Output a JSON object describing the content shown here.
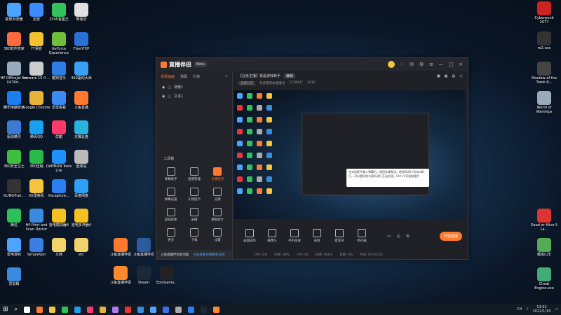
{
  "desktop_icons_left": [
    {
      "label": "联想浏览器\nHP OfficeJ...",
      "color": "#4aa3ff"
    },
    {
      "label": "迅雷",
      "color": "#3b8cff"
    },
    {
      "label": "2345看图王",
      "color": "#32c45b"
    },
    {
      "label": "网易云",
      "color": "#e0e0e0"
    },
    {
      "label": "360软件管家",
      "color": "#ff6b3d"
    },
    {
      "label": "YY语音",
      "color": "#f2c230"
    },
    {
      "label": "GeForce Experience",
      "color": "#6fbf3a"
    },
    {
      "label": "FlashFXP",
      "color": "#2b6fd9"
    },
    {
      "label": "HP Officejet Pro X476d...",
      "color": "#9ab"
    },
    {
      "label": "vmware 15 0 ...",
      "color": "#ccc"
    },
    {
      "label": "酷狗音乐",
      "color": "#2d7de3"
    },
    {
      "label": "360驱动大师",
      "color": "#39a0f5"
    },
    {
      "label": "腾讯电脑管家",
      "color": "#1b7ef0"
    },
    {
      "label": "Google Chrome",
      "color": "#e8b33b"
    },
    {
      "label": "迅雷看看",
      "color": "#3d8bf2"
    },
    {
      "label": "斗鱼直播",
      "color": "#ff7a2e"
    },
    {
      "label": "驱动精灵",
      "color": "#3a7bd5"
    },
    {
      "label": "腾讯QQ",
      "color": "#1aa0f0"
    },
    {
      "label": "优酷",
      "color": "#ff3a6a"
    },
    {
      "label": "天翼云盘",
      "color": "#2bb3e0"
    },
    {
      "label": "360安全卫士",
      "color": "#3fbf3f"
    },
    {
      "label": "360压缩",
      "color": "#2ab84a"
    },
    {
      "label": "DAEMON Tools Lite",
      "color": "#1f90ff"
    },
    {
      "label": "回收站",
      "color": "#bbb"
    },
    {
      "label": "KLINGTrail...",
      "color": "#333"
    },
    {
      "label": "KK录像机",
      "color": "#f5c542"
    },
    {
      "label": "Kscapture...",
      "color": "#2a7ff0"
    },
    {
      "label": "百度网盘",
      "color": "#2ea1f5"
    },
    {
      "label": "微信",
      "color": "#2dc15a"
    },
    {
      "label": "HP Print and Scan Doctor",
      "color": "#3a8be0"
    },
    {
      "label": "雷电模拟器4",
      "color": "#f5c020"
    },
    {
      "label": "雷电多开器4",
      "color": "#f5c020"
    },
    {
      "label": "雷电游戏",
      "color": "#4fa3ff"
    },
    {
      "label": "SimpleVpn",
      "color": "#3c7de0"
    },
    {
      "label": "文档",
      "color": "#f2d36b"
    },
    {
      "label": "etc",
      "color": "#f2d36b"
    },
    {
      "label": "爱剪辑",
      "color": "#3a8be0"
    }
  ],
  "desktop_icons_bottom": [
    {
      "label": "斗鱼直播伴侣\n直播伴侣",
      "color": "#ff7a2e"
    },
    {
      "label": "斗鱼直播伴侣",
      "color": "#2b5d9e"
    },
    {
      "label": "斗鱼直播伴侣",
      "color": "#ff8a2e"
    },
    {
      "label": "Steam",
      "color": "#1b2838"
    },
    {
      "label": "EpicGame...",
      "color": "#222"
    }
  ],
  "desktop_icons_right": [
    {
      "label": "Cyberpunk 2077",
      "color": "#c22"
    },
    {
      "label": "re2.exe",
      "color": "#333"
    },
    {
      "label": "Shadow of the Tomb R...",
      "color": "#444"
    },
    {
      "label": "World of Warships",
      "color": "#9ab"
    },
    {
      "label": "Dead or Alive 5 La...",
      "color": "#d33"
    },
    {
      "label": "模拟山羊",
      "color": "#5a5"
    },
    {
      "label": "Cheat Engine.exe",
      "color": "#4a7"
    }
  ],
  "app": {
    "logo": "直播伴侣",
    "version": "Beta",
    "tabs": [
      "场景画面",
      "弹幕",
      "礼物"
    ],
    "scenes": [
      "场景1",
      "文本1"
    ],
    "tools_title": "工具箱",
    "tools": [
      {
        "label": "弹幕助手",
        "orange": false
      },
      {
        "label": "直播管理",
        "orange": false
      },
      {
        "label": "主播任务",
        "orange": true
      },
      {
        "label": "弹幕设置",
        "orange": false
      },
      {
        "label": "礼物提示",
        "orange": false
      },
      {
        "label": "竞猜",
        "orange": false
      },
      {
        "label": "虚拟形象",
        "orange": false
      },
      {
        "label": "录播",
        "orange": false
      },
      {
        "label": "数据统计",
        "orange": false
      },
      {
        "label": "更多",
        "orange": false
      },
      {
        "label": "下载",
        "orange": false
      },
      {
        "label": "设置",
        "orange": false
      }
    ],
    "notice": "斗鱼直播伴侣新功能",
    "notice_link": "点击查看详细更新说明",
    "room_title": "【业余主播】我是游戏新手",
    "room_tag": "编辑",
    "room_info": [
      "直播分区",
      "欢迎来到本直播间",
      "1378937",
      "2410"
    ],
    "tooltip": "在对话框中输入弹幕后，按回车键发送，使用Shift+Enter换行，可以更好地与观众进行互动交流。Ctrl+V可粘贴图片",
    "bottom_tools": [
      "画面操作",
      "摄像头",
      "手机投屏",
      "录屏",
      "麦克风",
      "扬声器"
    ],
    "live_button": "开始直播",
    "stats": [
      "CPU: 6%",
      "内存: 48%",
      "FPS: 60",
      "码率: 0kb/s",
      "丢帧: 0%",
      "时长: 00:00:00"
    ]
  },
  "taskbar": {
    "icons": [
      "#fff",
      "#ff7a2e",
      "#f5c542",
      "#2dc15a",
      "#1aa0f0",
      "#ff3a6a",
      "#e8b33b",
      "#a77df7",
      "#e33",
      "#3a8be0",
      "#4fa3ff",
      "#3d6df2",
      "#aaa",
      "#2a7ff0",
      "#1b2838",
      "#ff8a2e"
    ],
    "lang": "CH",
    "time": "13:02",
    "date": "2022/1/18"
  }
}
